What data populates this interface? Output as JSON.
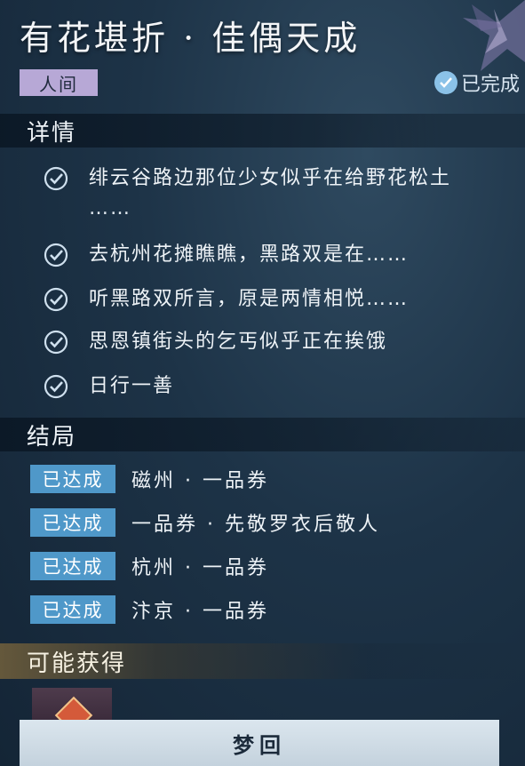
{
  "header": {
    "title": "有花堪折 · 佳偶天成",
    "realm_tag": "人间",
    "status": "已完成"
  },
  "details": {
    "heading": "详情",
    "tasks": [
      {
        "text": "绯云谷路边那位少女似乎在给野花松土",
        "cont": "……",
        "done": true
      },
      {
        "text": "去杭州花摊瞧瞧，黑路双是在……",
        "done": true
      },
      {
        "text": "听黑路双所言，原是两情相悦……",
        "done": true
      },
      {
        "text": "思恩镇街头的乞丐似乎正在挨饿",
        "done": true
      },
      {
        "text": "日行一善",
        "done": true
      }
    ]
  },
  "endings": {
    "heading": "结局",
    "items": [
      {
        "badge": "已达成",
        "name": "磁州 · 一品券"
      },
      {
        "badge": "已达成",
        "name": "一品券 · 先敬罗衣后敬人"
      },
      {
        "badge": "已达成",
        "name": "杭州 · 一品券"
      },
      {
        "badge": "已达成",
        "name": "汴京 · 一品券"
      }
    ]
  },
  "rewards": {
    "heading": "可能获得"
  },
  "footer": {
    "replay_label": "梦回"
  },
  "colors": {
    "badge": "#4f98c9",
    "realm_tag": "#b7a8d6",
    "check": "#8bc2e8"
  }
}
